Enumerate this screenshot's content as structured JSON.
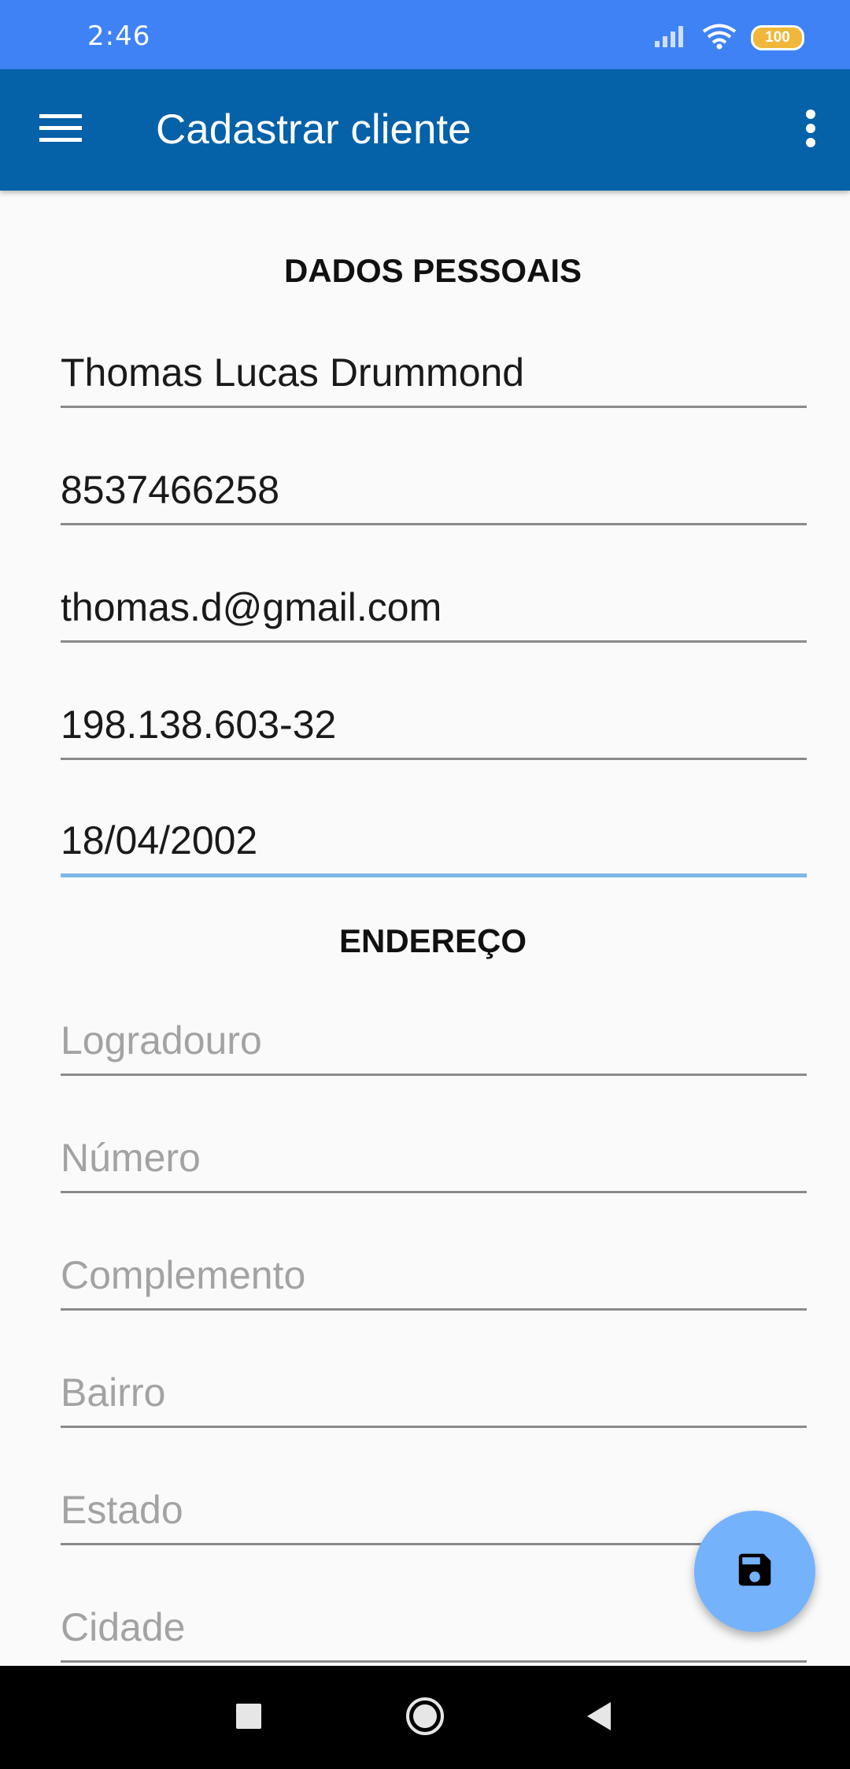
{
  "status_bar": {
    "time": "2:46",
    "battery": "100",
    "icons": [
      "signal-icon",
      "wifi-icon",
      "battery-icon"
    ]
  },
  "app_bar": {
    "title": "Cadastrar cliente",
    "menu_icon": "hamburger-menu-icon",
    "overflow_icon": "more-vert-icon",
    "color": "#0561a8"
  },
  "sections": {
    "personal": "DADOS PESSOAIS",
    "address": "ENDEREÇO"
  },
  "personal_fields": {
    "name": "Thomas Lucas Drummond",
    "phone": "8537466258",
    "email": "thomas.d@gmail.com",
    "cpf": "198.138.603-32",
    "birthdate": "18/04/2002"
  },
  "address_fields": {
    "street_placeholder": "Logradouro",
    "number_placeholder": "Número",
    "complement_placeholder": "Complemento",
    "neighborhood_placeholder": "Bairro",
    "state_placeholder": "Estado",
    "city_placeholder": "Cidade"
  },
  "fab": {
    "icon": "save-icon",
    "color": "#74b2fc"
  },
  "nav_bar": {
    "icons": [
      "recents-square-icon",
      "home-circle-icon",
      "back-triangle-icon"
    ]
  },
  "colors": {
    "status_bar": "#3f82f5",
    "focused_underline": "#7db8e8",
    "placeholder": "#a3a3a3"
  }
}
